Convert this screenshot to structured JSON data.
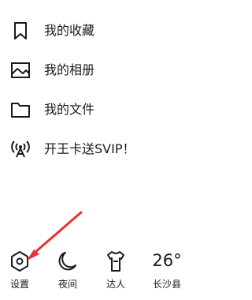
{
  "menu": {
    "items": [
      {
        "label": "我的收藏",
        "icon": "bookmark-icon"
      },
      {
        "label": "我的相册",
        "icon": "image-icon"
      },
      {
        "label": "我的文件",
        "icon": "folder-icon"
      },
      {
        "label": "开王卡送SVIP！",
        "icon": "antenna-icon"
      }
    ]
  },
  "bottom_bar": {
    "settings_label": "设置",
    "night_label": "夜间",
    "expert_label": "达人",
    "weather": {
      "temperature": "26°",
      "city": "长沙县"
    }
  },
  "annotation": {
    "arrow_color": "#e8332d"
  }
}
